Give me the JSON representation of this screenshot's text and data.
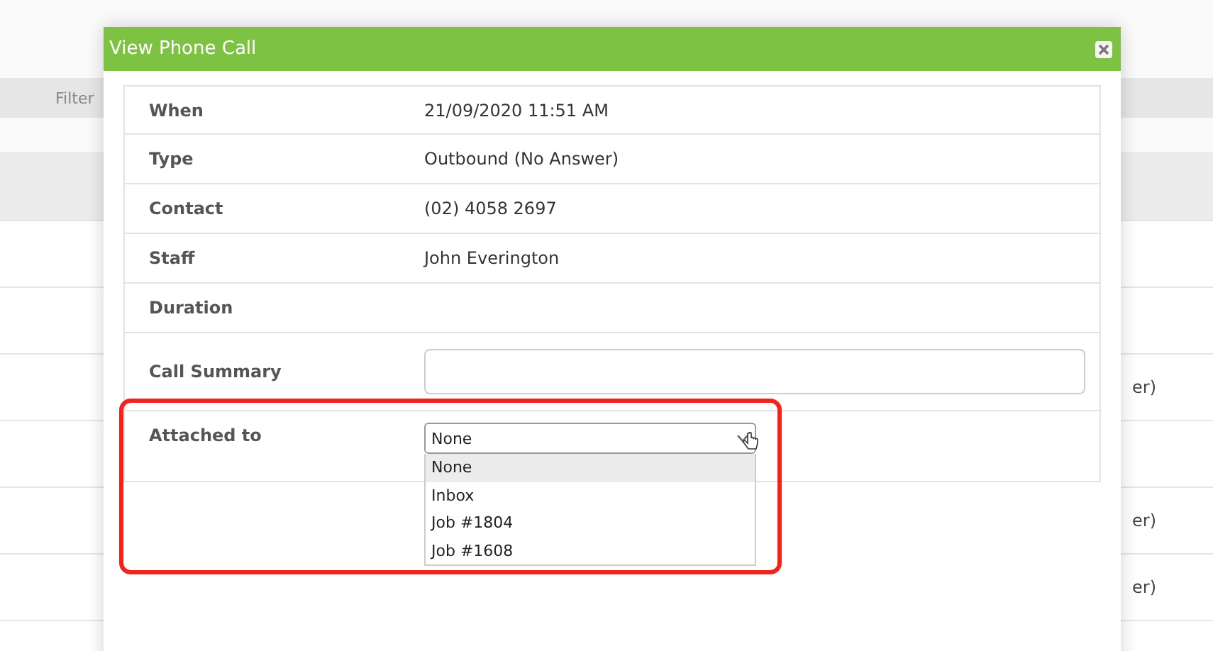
{
  "background": {
    "filter_label": "Filter",
    "rows": [
      {
        "kind": "empty"
      },
      {
        "kind": "empty"
      },
      {
        "kind": "text",
        "cell": "er)"
      },
      {
        "kind": "empty"
      },
      {
        "kind": "text",
        "cell": "er)"
      },
      {
        "kind": "text",
        "cell": "er)"
      },
      {
        "kind": "empty"
      }
    ]
  },
  "dialog": {
    "title": "View Phone Call",
    "fields": [
      {
        "kind": "text",
        "label": "When",
        "value": "21/09/2020 11:51 AM"
      },
      {
        "kind": "text",
        "label": "Type",
        "value": "Outbound (No Answer)"
      },
      {
        "kind": "text",
        "label": "Contact",
        "value": "(02) 4058 2697"
      },
      {
        "kind": "text",
        "label": "Staff",
        "value": "John Everington"
      },
      {
        "kind": "text",
        "label": "Duration"
      },
      {
        "kind": "input",
        "label": "Call Summary"
      },
      {
        "kind": "select",
        "label": "Attached to",
        "value": "None",
        "expanded": true,
        "options": [
          {
            "label": "None",
            "selected": true
          },
          {
            "label": "Inbox",
            "selected": false
          },
          {
            "label": "Job #1804",
            "selected": false
          },
          {
            "label": "Job #1608",
            "selected": false
          }
        ]
      }
    ]
  }
}
